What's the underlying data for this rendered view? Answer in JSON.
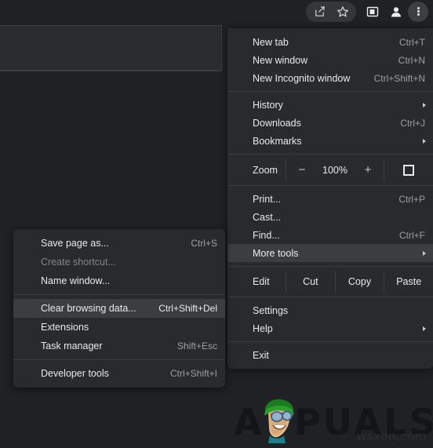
{
  "toolbar": {
    "icons": [
      {
        "name": "share-icon",
        "label": "Share this page"
      },
      {
        "name": "star-icon",
        "label": "Bookmark this tab"
      },
      {
        "name": "side-panel-icon",
        "label": "Side panel"
      },
      {
        "name": "profile-avatar-icon",
        "label": "Profile"
      },
      {
        "name": "three-dot-menu-icon",
        "label": "Customize and control Google Chrome"
      }
    ]
  },
  "main_menu": {
    "groups": [
      {
        "items": [
          {
            "label": "New tab",
            "accel": "Ctrl+T",
            "arrow": false,
            "highlighted": false,
            "disabled": false
          },
          {
            "label": "New window",
            "accel": "Ctrl+N",
            "arrow": false,
            "highlighted": false,
            "disabled": false
          },
          {
            "label": "New Incognito window",
            "accel": "Ctrl+Shift+N",
            "arrow": false,
            "highlighted": false,
            "disabled": false
          }
        ]
      },
      {
        "items": [
          {
            "label": "History",
            "accel": "",
            "arrow": true,
            "highlighted": false,
            "disabled": false
          },
          {
            "label": "Downloads",
            "accel": "Ctrl+J",
            "arrow": false,
            "highlighted": false,
            "disabled": false
          },
          {
            "label": "Bookmarks",
            "accel": "",
            "arrow": true,
            "highlighted": false,
            "disabled": false
          }
        ]
      },
      {
        "items": [
          {
            "label": "Print...",
            "accel": "Ctrl+P",
            "arrow": false,
            "highlighted": false,
            "disabled": false
          },
          {
            "label": "Cast...",
            "accel": "",
            "arrow": false,
            "highlighted": false,
            "disabled": false
          },
          {
            "label": "Find...",
            "accel": "Ctrl+F",
            "arrow": false,
            "highlighted": false,
            "disabled": false
          },
          {
            "label": "More tools",
            "accel": "",
            "arrow": true,
            "highlighted": true,
            "disabled": false
          }
        ]
      },
      {
        "items": [
          {
            "label": "Settings",
            "accel": "",
            "arrow": false,
            "highlighted": false,
            "disabled": false
          },
          {
            "label": "Help",
            "accel": "",
            "arrow": true,
            "highlighted": false,
            "disabled": false
          }
        ]
      },
      {
        "items": [
          {
            "label": "Exit",
            "accel": "",
            "arrow": false,
            "highlighted": false,
            "disabled": false
          }
        ]
      }
    ],
    "zoom_row": {
      "label": "Zoom",
      "minus": "−",
      "value": "100%",
      "plus": "+",
      "fullscreen_icon": "fullscreen-icon"
    },
    "edit_row": {
      "label": "Edit",
      "buttons": [
        "Cut",
        "Copy",
        "Paste"
      ]
    }
  },
  "sub_menu": {
    "groups": [
      {
        "items": [
          {
            "label": "Save page as...",
            "accel": "Ctrl+S",
            "highlighted": false,
            "disabled": false
          },
          {
            "label": "Create shortcut...",
            "accel": "",
            "highlighted": false,
            "disabled": true
          },
          {
            "label": "Name window...",
            "accel": "",
            "highlighted": false,
            "disabled": false
          }
        ]
      },
      {
        "items": [
          {
            "label": "Clear browsing data...",
            "accel": "Ctrl+Shift+Del",
            "highlighted": true,
            "disabled": false
          },
          {
            "label": "Extensions",
            "accel": "",
            "highlighted": false,
            "disabled": false
          },
          {
            "label": "Task manager",
            "accel": "Shift+Esc",
            "highlighted": false,
            "disabled": false
          }
        ]
      },
      {
        "items": [
          {
            "label": "Developer tools",
            "accel": "Ctrl+Shift+I",
            "highlighted": false,
            "disabled": false
          }
        ]
      }
    ]
  },
  "watermark": {
    "brand": "APPUALS",
    "brand_prefix": "A",
    "brand_suffix": "PUALS",
    "source": "wsxdn.com"
  },
  "colors": {
    "menu_bg": "#292a2d",
    "menu_highlight": "#3c3d40",
    "text": "#e8eaed",
    "accel_text": "#9aa0a6",
    "disabled_text": "#80868b",
    "separator": "#3c3d40",
    "page_bg": "#202124",
    "toolbar_bg": "#1f2125"
  }
}
